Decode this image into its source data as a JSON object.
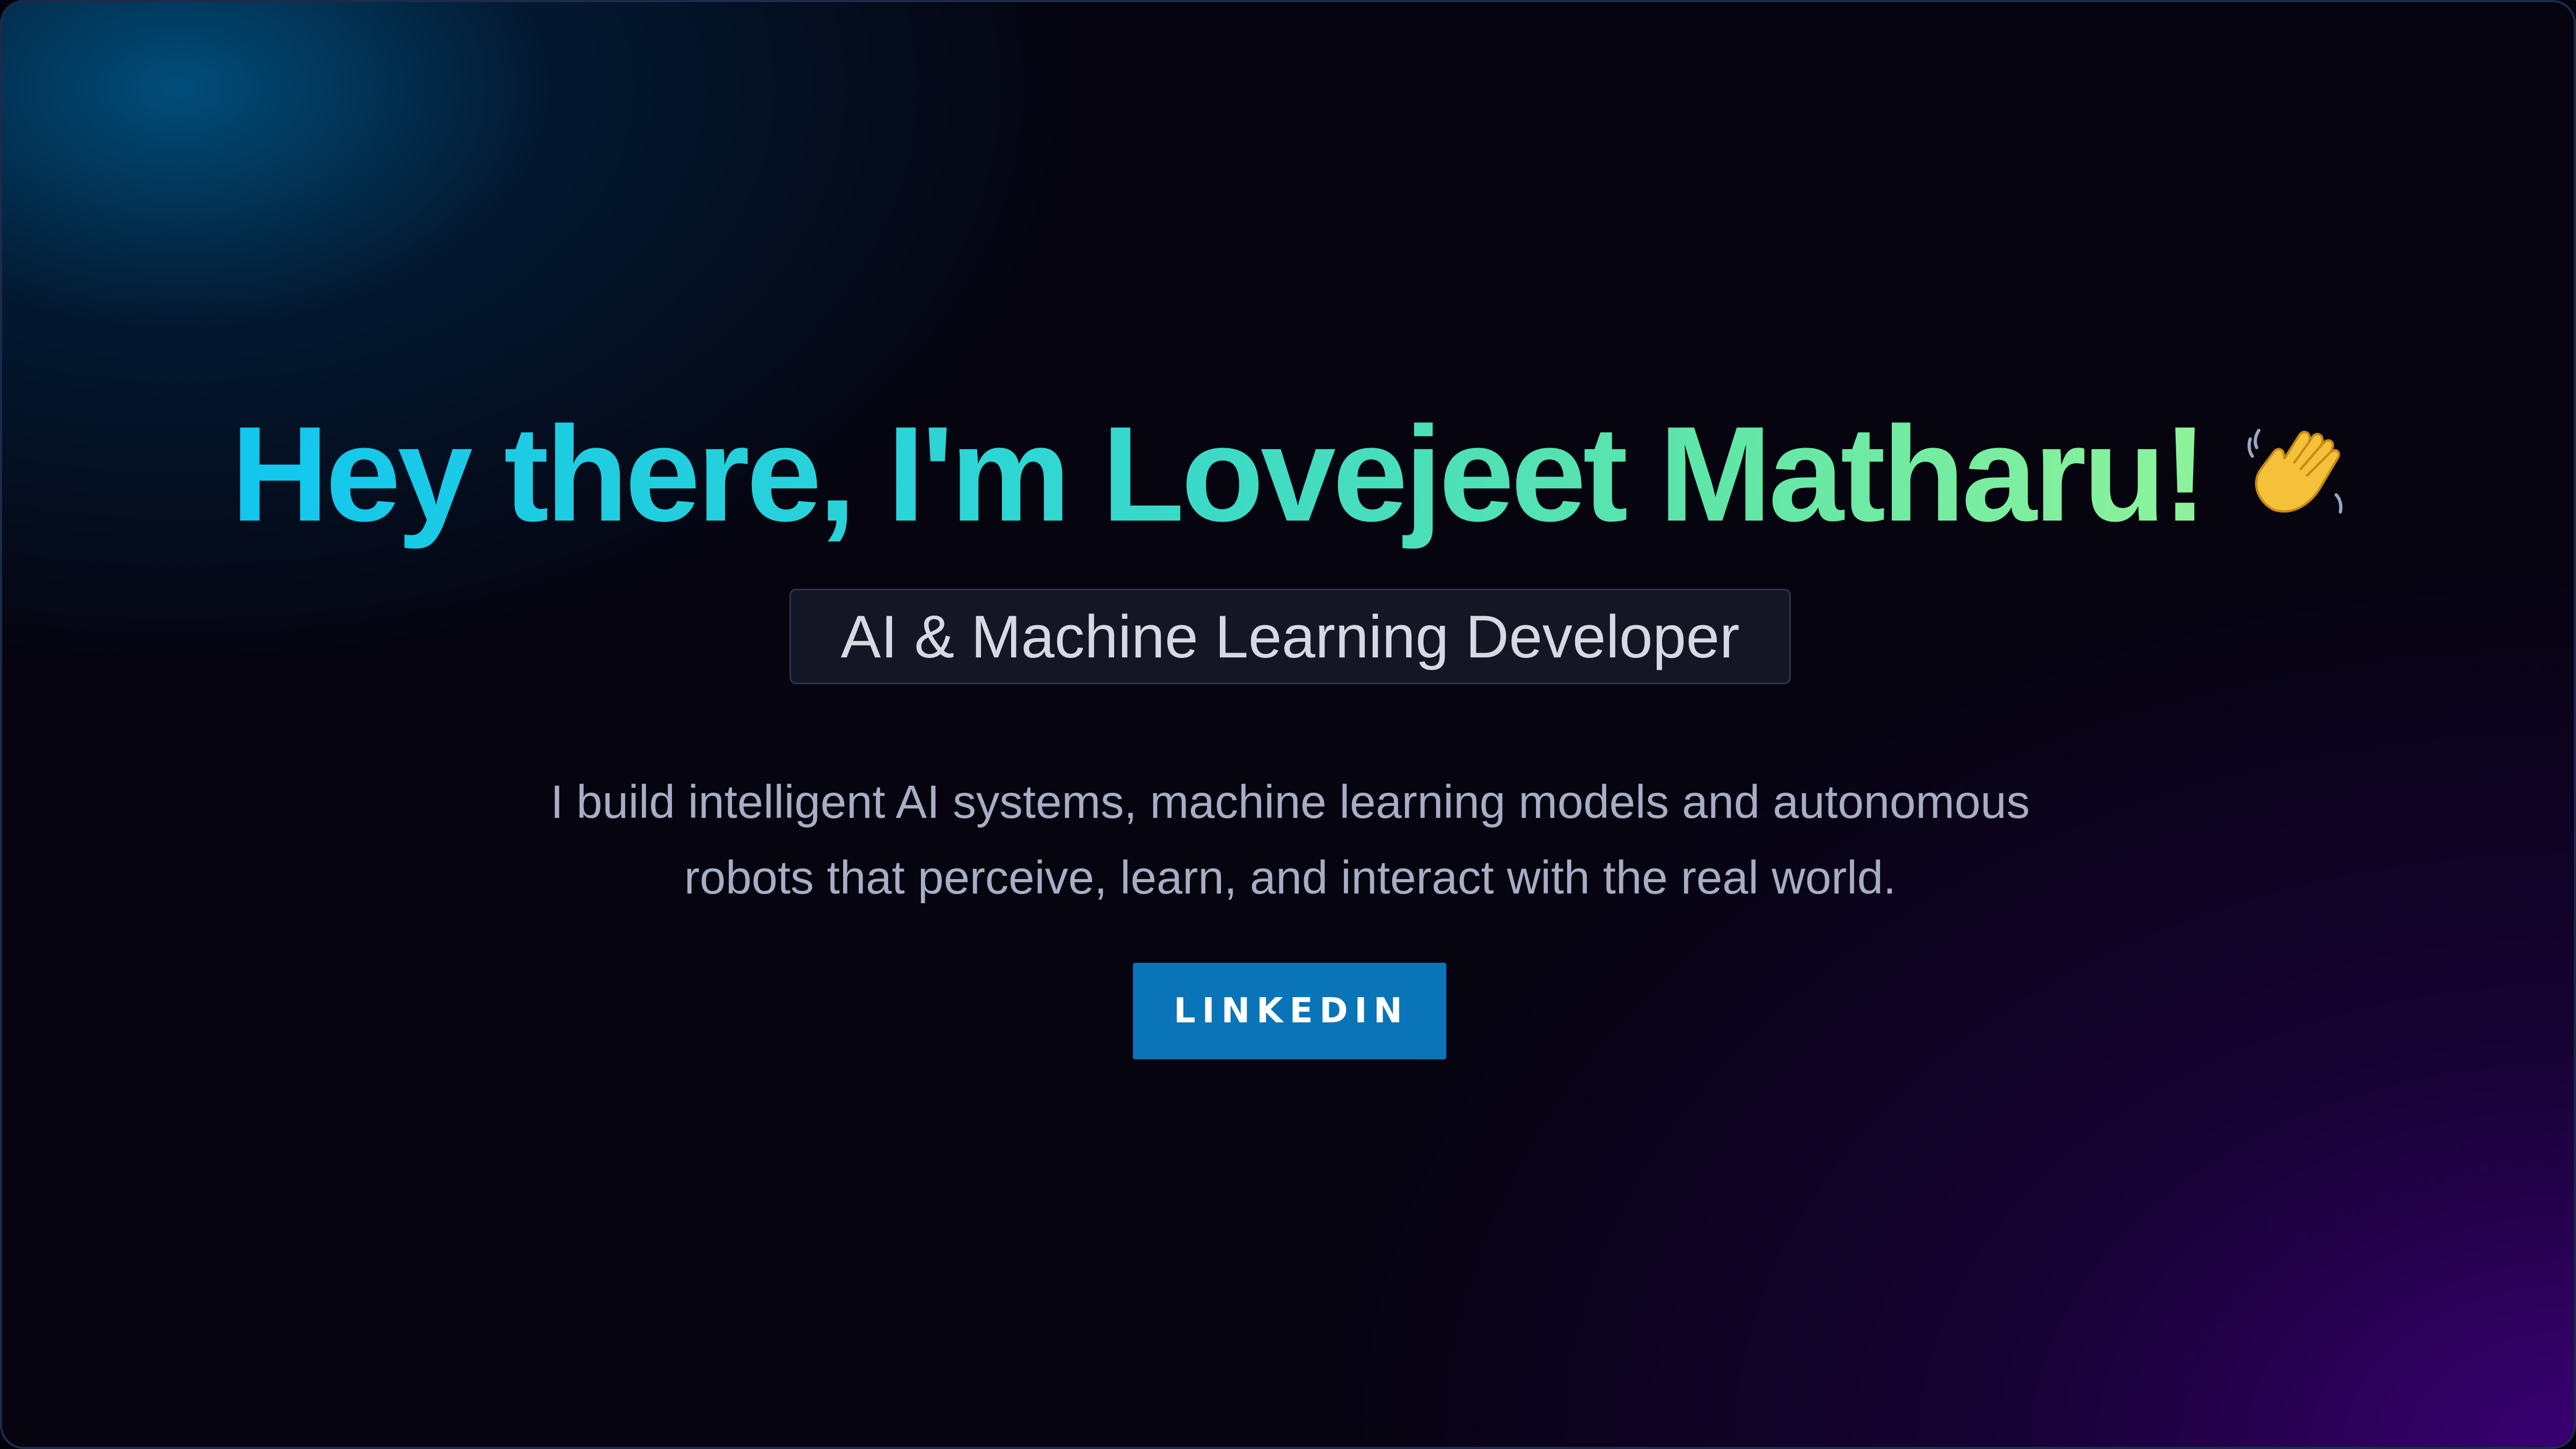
{
  "hero": {
    "headline": "Hey there, I'm Lovejeet Matharu!",
    "wave_icon": "waving-hand-icon",
    "role": "AI & Machine Learning Developer",
    "bio_line1": "I build intelligent AI systems, machine learning models and autonomous",
    "bio_line2": "robots that perceive, learn, and interact with the real world.",
    "cta_label": "LINKEDIN"
  },
  "colors": {
    "headline_gradient_start": "#12c6ee",
    "headline_gradient_end": "#8ef39a",
    "button_background": "#0a74b8",
    "background_dark": "#05040f",
    "glow_blue": "#005a8c",
    "glow_purple": "#3c0078"
  }
}
